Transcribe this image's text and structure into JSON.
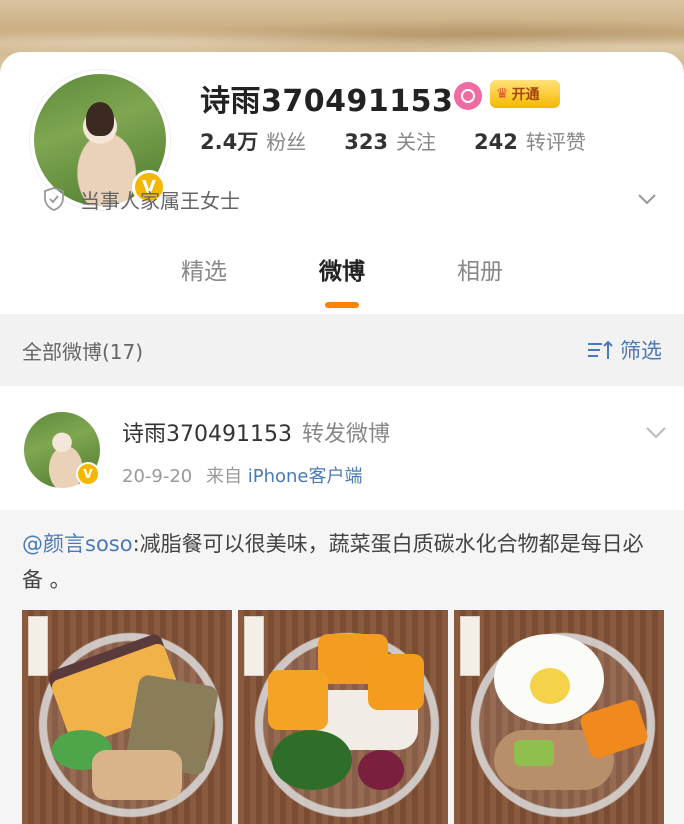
{
  "profile": {
    "username": "诗雨370491153",
    "vip_label": "开通",
    "verify_mark": "V",
    "stats": [
      {
        "value": "2.4万",
        "label": "粉丝"
      },
      {
        "value": "323",
        "label": "关注"
      },
      {
        "value": "242",
        "label": "转评赞"
      }
    ],
    "description": "当事人家属王女士"
  },
  "tabs": [
    {
      "label": "精选",
      "active": false
    },
    {
      "label": "微博",
      "active": true
    },
    {
      "label": "相册",
      "active": false
    }
  ],
  "filter_bar": {
    "count_label": "全部微博(17)",
    "filter_label": "筛选"
  },
  "post": {
    "username": "诗雨370491153",
    "action": "转发微博",
    "date": "20-9-20",
    "source_prefix": "来自",
    "source": "iPhone客户端",
    "verify_mark": "V",
    "repost": {
      "mention": "@颜言soso",
      "text": ":减脂餐可以很美味，蔬菜蛋白质碳水化合物都是每日必备 。"
    }
  },
  "colors": {
    "accent": "#ff8200",
    "link": "#4a79b8",
    "verify": "#f5b800"
  }
}
